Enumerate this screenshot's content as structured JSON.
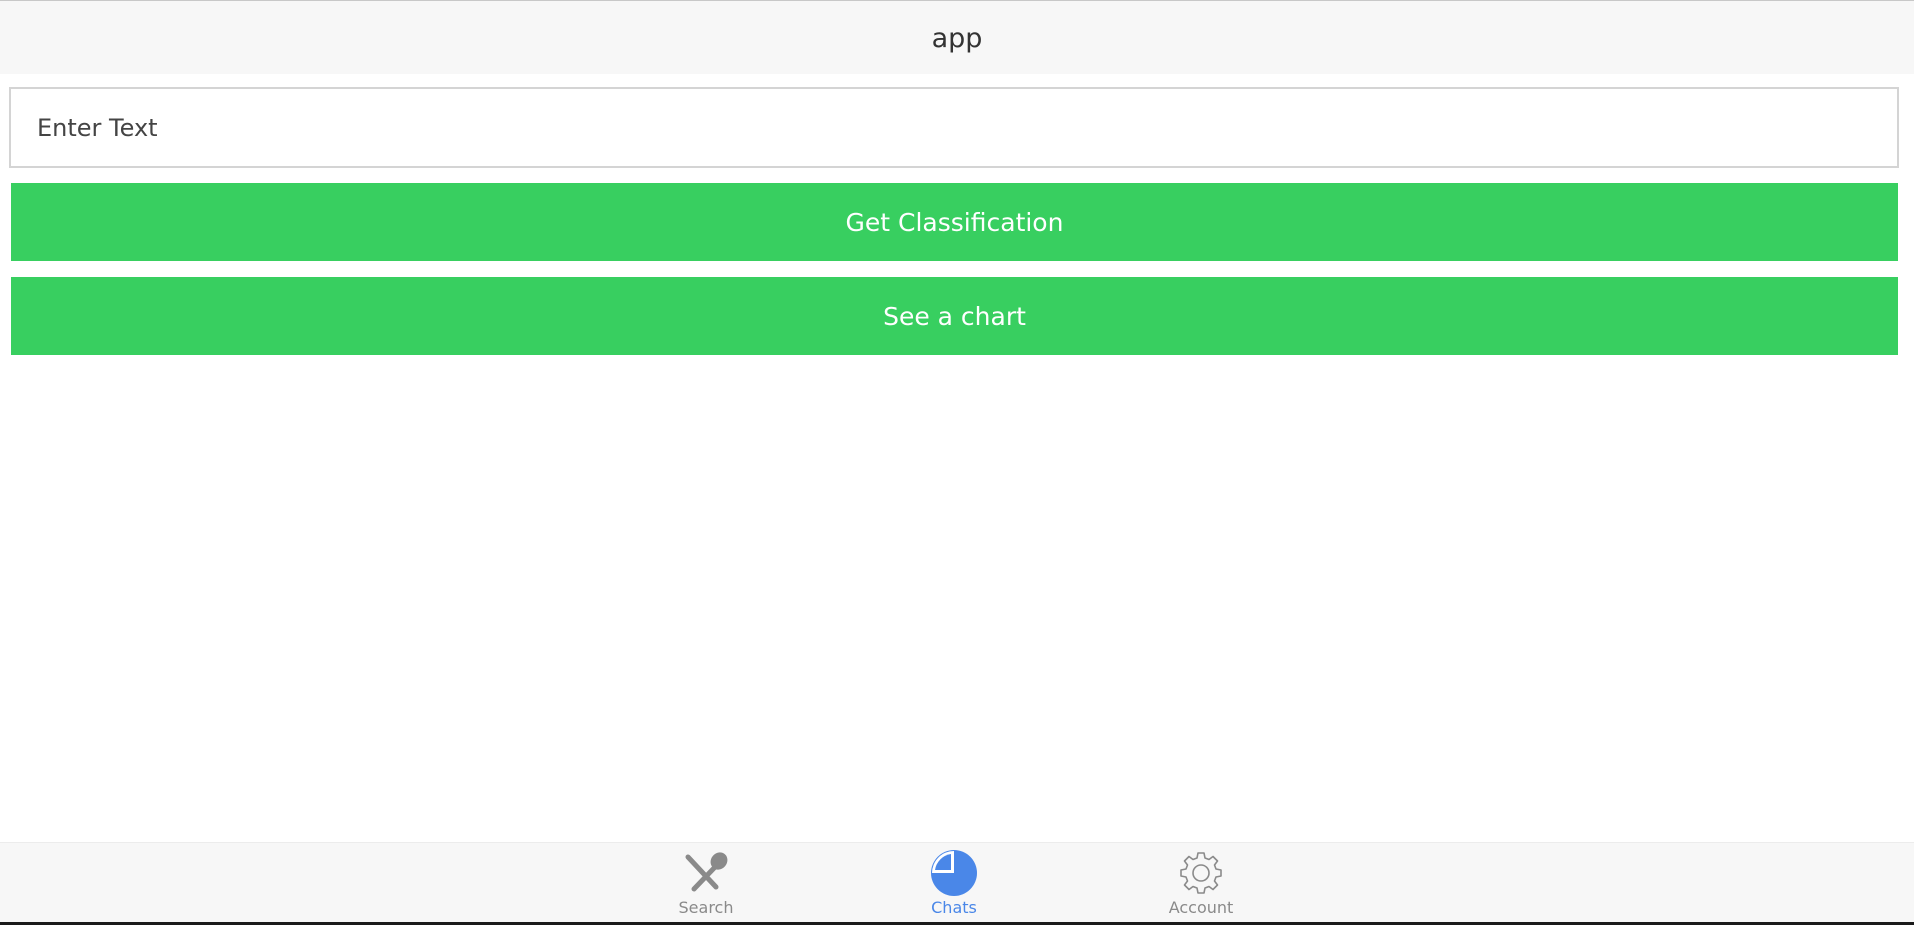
{
  "header": {
    "title": "app"
  },
  "form": {
    "text_placeholder": "Enter Text",
    "text_value": "",
    "classify_label": "Get Classification",
    "chart_label": "See a chart"
  },
  "tabs": [
    {
      "label": "Search",
      "icon": "utensils-icon",
      "active": false
    },
    {
      "label": "Chats",
      "icon": "pie-chart-icon",
      "active": true
    },
    {
      "label": "Account",
      "icon": "gear-icon",
      "active": false
    }
  ],
  "colors": {
    "accent_green": "#38cf60",
    "active_tab": "#4a87e8",
    "inactive_tab": "#8a8a8a",
    "bar_background": "#f7f7f7"
  }
}
